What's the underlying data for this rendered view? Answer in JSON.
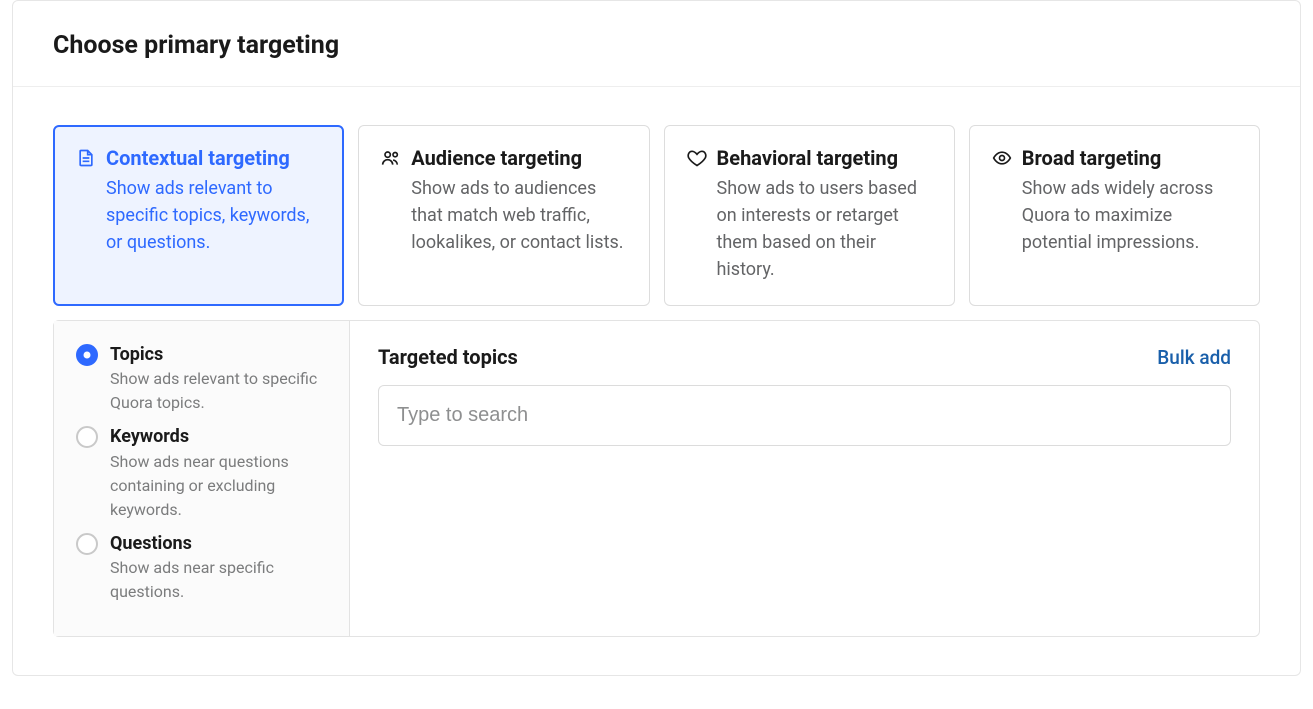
{
  "header": {
    "title": "Choose primary targeting"
  },
  "cards": {
    "contextual": {
      "title": "Contextual targeting",
      "desc": "Show ads relevant to specific topics, keywords, or questions."
    },
    "audience": {
      "title": "Audience targeting",
      "desc": "Show ads to audiences that match web traffic, lookalikes, or contact lists."
    },
    "behavioral": {
      "title": "Behavioral targeting",
      "desc": "Show ads to users based on interests or retarget them based on their history."
    },
    "broad": {
      "title": "Broad targeting",
      "desc": "Show ads widely across Quora to maximize potential impressions."
    }
  },
  "sidebar": {
    "topics": {
      "title": "Topics",
      "desc": "Show ads relevant to specific Quora topics."
    },
    "keywords": {
      "title": "Keywords",
      "desc": "Show ads near questions containing or excluding keywords."
    },
    "questions": {
      "title": "Questions",
      "desc": "Show ads near specific questions."
    }
  },
  "main": {
    "title": "Targeted topics",
    "bulk_add_label": "Bulk add",
    "search_placeholder": "Type to search"
  }
}
